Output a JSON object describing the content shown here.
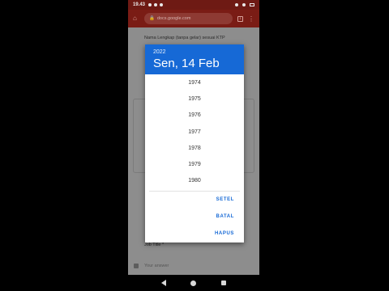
{
  "status": {
    "time": "19.43"
  },
  "browser": {
    "url": "docs.google.com"
  },
  "form": {
    "question1": "Nama Lengkap (tanpa gelar) sesuai KTP",
    "question_job": "Job Title *",
    "answer_placeholder": "Your answer"
  },
  "dialog": {
    "year": "2022",
    "date": "Sen, 14 Feb",
    "years": [
      "1974",
      "1975",
      "1976",
      "1977",
      "1978",
      "1979",
      "1980"
    ],
    "actions": {
      "set": "SETEL",
      "cancel": "BATAL",
      "clear": "HAPUS"
    }
  }
}
